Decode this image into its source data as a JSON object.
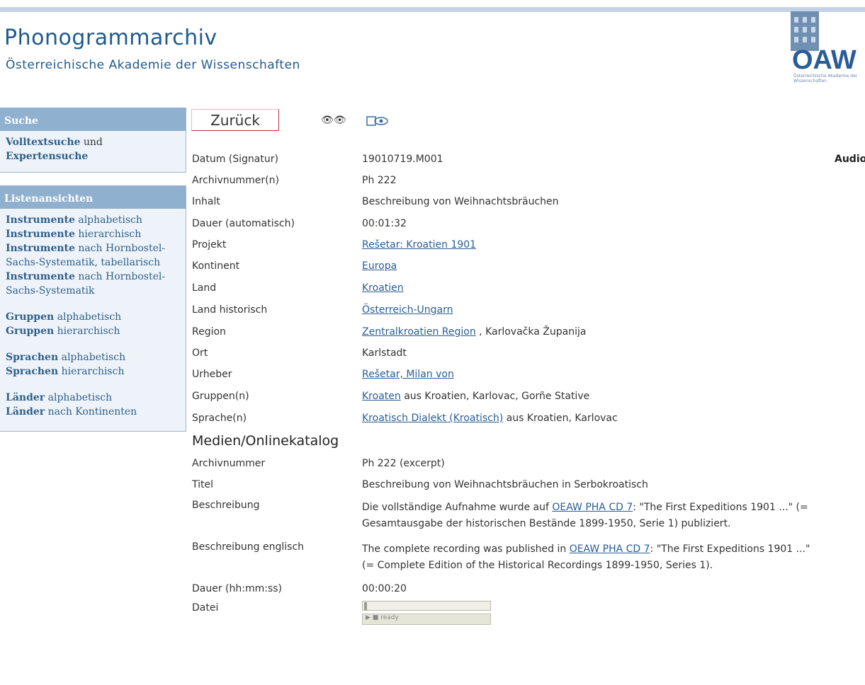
{
  "header": {
    "title": "Phonogrammarchiv",
    "subtitle": "Österreichische Akademie der Wissenschaften",
    "logo_text": "OAW",
    "logo_small": "Österreichische Akademie der Wissenschaften"
  },
  "sidebar": {
    "search": {
      "heading": "Suche",
      "link1": "Volltextsuche",
      "conj": " und",
      "link2": "Expertensuche"
    },
    "lists": {
      "heading": "Listenansichten",
      "items": [
        {
          "bold": "Instrumente",
          "rest": " alphabetisch"
        },
        {
          "bold": "Instrumente",
          "rest": " hierarchisch"
        },
        {
          "bold": "Instrumente",
          "rest": " nach Hornbostel-Sachs-Systematik, tabellarisch"
        },
        {
          "bold": "Instrumente",
          "rest": " nach Hornbostel-Sachs-Systematik"
        },
        {
          "bold": "Gruppen",
          "rest": " alphabetisch"
        },
        {
          "bold": "Gruppen",
          "rest": " hierarchisch"
        },
        {
          "bold": "Sprachen",
          "rest": " alphabetisch"
        },
        {
          "bold": "Sprachen",
          "rest": " hierarchisch"
        },
        {
          "bold": "Länder",
          "rest": " alphabetisch"
        },
        {
          "bold": "Länder",
          "rest": " nach Kontinenten"
        }
      ]
    }
  },
  "toolbar": {
    "back_label": "Zurück",
    "search_icon": "binoculars-icon",
    "view_icon": "view-icon"
  },
  "record": {
    "audio_label": "Audio",
    "fields": {
      "datum": {
        "label": "Datum (Signatur)",
        "value": "19010719.M001"
      },
      "archiv": {
        "label": "Archivnummer(n)",
        "value": "Ph 222"
      },
      "inhalt": {
        "label": "Inhalt",
        "value": "Beschreibung von Weihnachtsbräuchen"
      },
      "dauer": {
        "label": "Dauer (automatisch)",
        "value": "00:01:32"
      },
      "projekt": {
        "label": "Projekt",
        "link": "Rešetar: Kroatien 1901"
      },
      "kontinent": {
        "label": "Kontinent",
        "link": "Europa"
      },
      "land": {
        "label": "Land",
        "link": "Kroatien"
      },
      "land_hist": {
        "label": "Land historisch",
        "link": "Österreich-Ungarn"
      },
      "region": {
        "label": "Region",
        "link": "Zentralkroatien Region",
        "rest": " , Karlovačka Županija"
      },
      "ort": {
        "label": "Ort",
        "value": "Karlstadt"
      },
      "urheber": {
        "label": "Urheber",
        "link": "Rešetar, Milan von"
      },
      "gruppen": {
        "label": "Gruppen(n)",
        "link": "Kroaten",
        "rest": " aus Kroatien, Karlovac, Gorñe Stative"
      },
      "sprache": {
        "label": "Sprache(n)",
        "link": "Kroatisch Dialekt (Kroatisch)",
        "rest": " aus Kroatien, Karlovac"
      }
    }
  },
  "media": {
    "heading": "Medien/Onlinekatalog",
    "archiv": {
      "label": "Archivnummer",
      "value": "Ph 222 (excerpt)"
    },
    "titel": {
      "label": "Titel",
      "value": "Beschreibung von Weihnachtsbräuchen in Serbokroatisch"
    },
    "beschreibung": {
      "label": "Beschreibung",
      "pre": "Die vollständige Aufnahme wurde auf ",
      "link": "OEAW PHA CD 7",
      "post1": ": \"The First Expeditions 1901 ...\" (=",
      "line2": "Gesamtausgabe der historischen Bestände 1899-1950, Serie 1) publiziert."
    },
    "beschreibung_en": {
      "label": "Beschreibung englisch",
      "pre": "The complete recording was published in ",
      "link": "OEAW PHA CD 7",
      "post1": ": \"The First Expeditions 1901 ...\"",
      "line2": "(= Complete Edition of the Historical Recordings 1899-1950, Series 1)."
    },
    "dauer": {
      "label": "Dauer (hh:mm:ss)",
      "value": "00:00:20"
    },
    "datei": {
      "label": "Datei",
      "player_status": "ready"
    }
  }
}
